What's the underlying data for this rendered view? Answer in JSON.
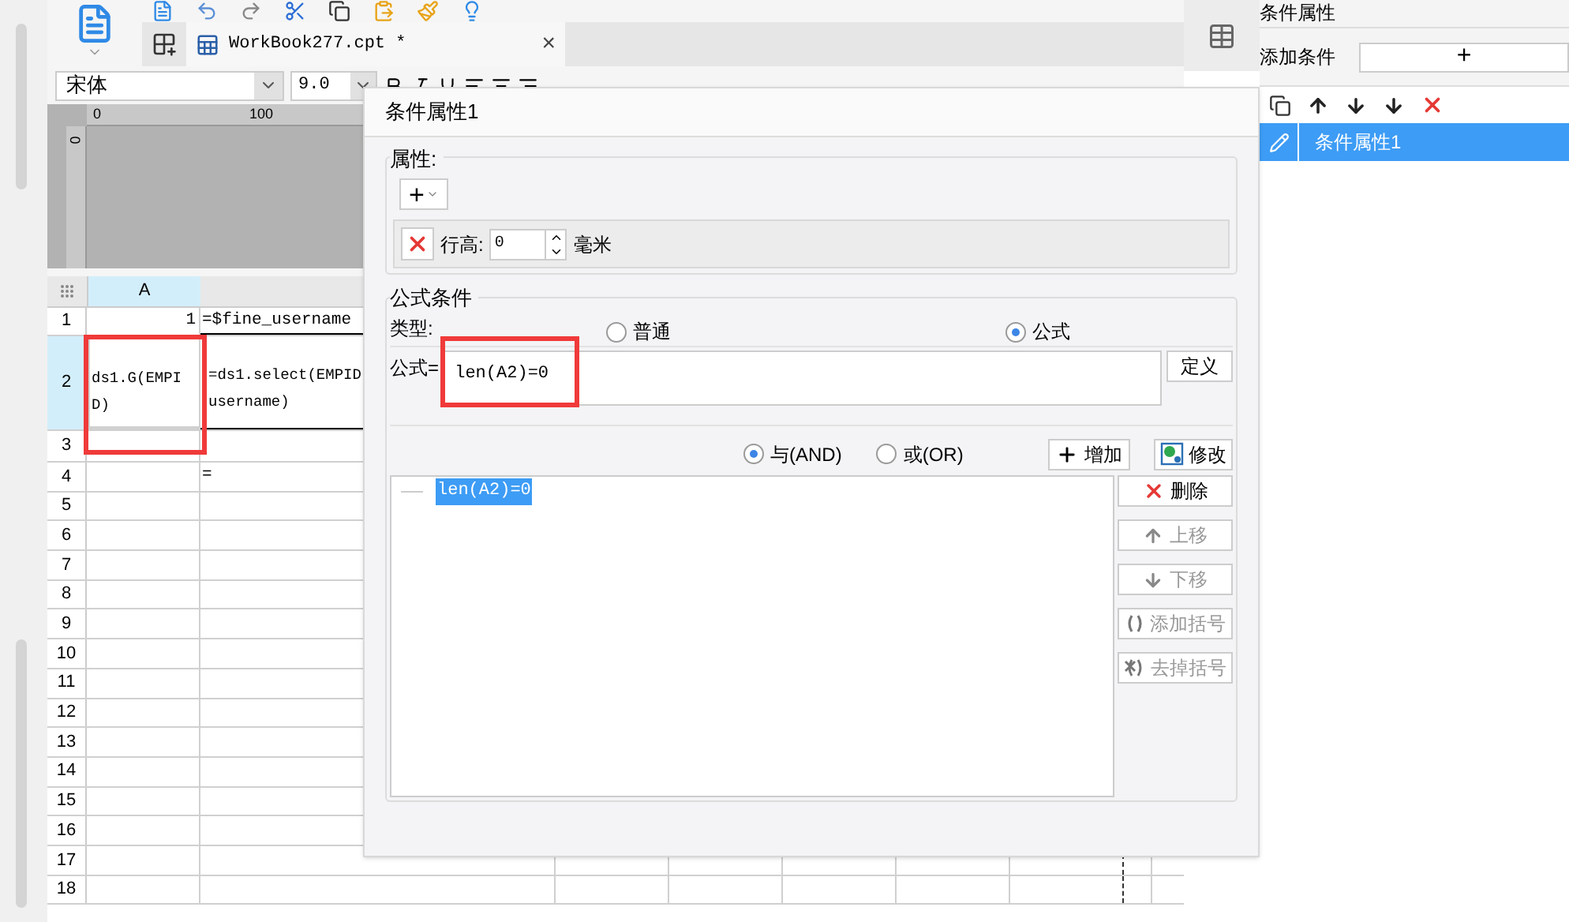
{
  "toolbar": {
    "font_name": "宋体",
    "font_size": "9.0"
  },
  "tab": {
    "title": "WorkBook277.cpt *",
    "close": "×"
  },
  "ruler": {
    "top_ticks": [
      "0",
      "100"
    ],
    "side_tick": "0"
  },
  "sheet": {
    "columns": [
      {
        "label": "A",
        "selected": true
      }
    ],
    "rows": [
      {
        "number": "1",
        "selected": false,
        "cells": [
          "1",
          "=$fine_username"
        ]
      },
      {
        "number": "2",
        "selected": true,
        "cells": [
          "ds1.G(EMPID)",
          "=ds1.select(EMPID username)"
        ]
      },
      {
        "number": "3",
        "selected": false,
        "cells": [
          "",
          ""
        ]
      },
      {
        "number": "4",
        "selected": false,
        "cells": [
          "",
          "="
        ]
      },
      {
        "number": "5",
        "selected": false,
        "cells": [
          "",
          ""
        ]
      },
      {
        "number": "6",
        "selected": false,
        "cells": [
          "",
          ""
        ]
      },
      {
        "number": "7",
        "selected": false,
        "cells": [
          "",
          ""
        ]
      },
      {
        "number": "8",
        "selected": false,
        "cells": [
          "",
          ""
        ]
      },
      {
        "number": "9",
        "selected": false,
        "cells": [
          "",
          ""
        ]
      },
      {
        "number": "10",
        "selected": false,
        "cells": [
          "",
          ""
        ]
      },
      {
        "number": "11",
        "selected": false,
        "cells": [
          "",
          ""
        ]
      },
      {
        "number": "12",
        "selected": false,
        "cells": [
          "",
          ""
        ]
      },
      {
        "number": "13",
        "selected": false,
        "cells": [
          "",
          ""
        ]
      },
      {
        "number": "14",
        "selected": false,
        "cells": [
          "",
          ""
        ]
      },
      {
        "number": "15",
        "selected": false,
        "cells": [
          "",
          ""
        ]
      },
      {
        "number": "16",
        "selected": false,
        "cells": [
          "",
          ""
        ]
      },
      {
        "number": "17",
        "selected": false,
        "cells": [
          "",
          ""
        ]
      },
      {
        "number": "18",
        "selected": false,
        "cells": [
          "",
          ""
        ]
      }
    ]
  },
  "dialog": {
    "title": "条件属性1",
    "property_section": {
      "legend": "属性:",
      "add": "+",
      "row_height_label": "行高:",
      "row_height_value": "0",
      "unit": "毫米"
    },
    "formula_section": {
      "legend": "公式条件",
      "type_label": "类型:",
      "types": [
        {
          "label": "普通",
          "selected": false
        },
        {
          "label": "公式",
          "selected": true
        }
      ],
      "formula_label": "公式=",
      "formula": "len(A2)=0",
      "define_button": "定义",
      "logic": [
        {
          "label": "与(AND)",
          "selected": true
        },
        {
          "label": "或(OR)",
          "selected": false
        }
      ],
      "add_button": "增加",
      "modify_button": "修改",
      "conditions": [
        {
          "label": "len(A2)=0",
          "selected": true
        }
      ],
      "side_buttons": [
        {
          "kind": "delete",
          "label": "删除",
          "disabled": false
        },
        {
          "kind": "up",
          "label": "上移",
          "disabled": true
        },
        {
          "kind": "down",
          "label": "下移",
          "disabled": true
        },
        {
          "kind": "add-brackets",
          "label": "添加括号",
          "disabled": true
        },
        {
          "kind": "remove-brackets",
          "label": "去掉括号",
          "disabled": true
        }
      ]
    }
  },
  "right_panel": {
    "title": "条件属性",
    "add_label": "添加条件",
    "add_button": "+",
    "items": [
      {
        "label": "条件属性1",
        "selected": true
      }
    ]
  }
}
